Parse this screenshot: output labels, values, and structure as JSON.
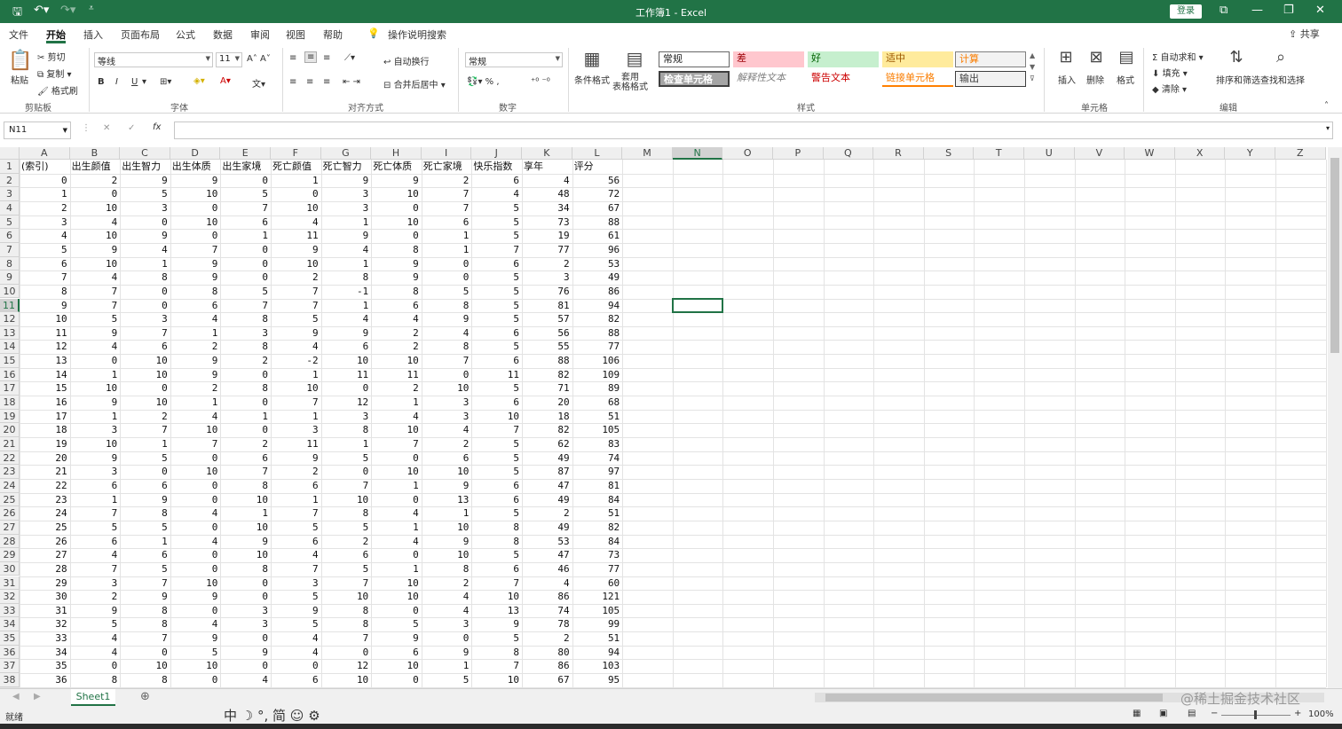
{
  "app": {
    "window_title": "工作簿1  -  Excel",
    "login": "登录"
  },
  "menu": [
    "文件",
    "开始",
    "插入",
    "页面布局",
    "公式",
    "数据",
    "审阅",
    "视图",
    "帮助"
  ],
  "menu_active": "开始",
  "tell_me": "操作说明搜索",
  "share": "共享",
  "ribbon": {
    "clipboard": {
      "paste": "粘贴",
      "cut": "剪切",
      "copy": "复制",
      "format_painter": "格式刷",
      "label": "剪贴板"
    },
    "font": {
      "name": "等线",
      "size": "11",
      "bold": "B",
      "italic": "I",
      "underline": "U",
      "label": "字体"
    },
    "align": {
      "wrap": "自动换行",
      "merge": "合并后居中",
      "label": "对齐方式"
    },
    "number": {
      "format": "常规",
      "label": "数字"
    },
    "styles": {
      "cond_format": "条件格式",
      "table_format": "套用\n表格格式",
      "cells": [
        "常规",
        "差",
        "好",
        "适中",
        "计算",
        "检查单元格",
        "解释性文本",
        "警告文本",
        "链接单元格",
        "输出"
      ],
      "label": "样式"
    },
    "cells": {
      "insert": "插入",
      "delete": "删除",
      "format": "格式",
      "label": "单元格"
    },
    "editing": {
      "autosum": "自动求和",
      "fill": "填充",
      "clear": "清除",
      "sort": "排序和筛选",
      "find": "查找和选择",
      "label": "编辑"
    }
  },
  "namebox": "N11",
  "columns": [
    "A",
    "B",
    "C",
    "D",
    "E",
    "F",
    "G",
    "H",
    "I",
    "J",
    "K",
    "L",
    "M",
    "N",
    "O",
    "P",
    "Q",
    "R",
    "S",
    "T",
    "U",
    "V",
    "W",
    "X",
    "Y",
    "Z"
  ],
  "header_row": [
    "(索引)",
    "出生颜值",
    "出生智力",
    "出生体质",
    "出生家境",
    "死亡颜值",
    "死亡智力",
    "死亡体质",
    "死亡家境",
    "快乐指数",
    "享年",
    "评分"
  ],
  "rows": [
    [
      0,
      2,
      9,
      9,
      0,
      1,
      9,
      9,
      2,
      6,
      4,
      56
    ],
    [
      1,
      0,
      5,
      10,
      5,
      0,
      3,
      10,
      7,
      4,
      48,
      72
    ],
    [
      2,
      10,
      3,
      0,
      7,
      10,
      3,
      0,
      7,
      5,
      34,
      67
    ],
    [
      3,
      4,
      0,
      10,
      6,
      4,
      1,
      10,
      6,
      5,
      73,
      88
    ],
    [
      4,
      10,
      9,
      0,
      1,
      11,
      9,
      0,
      1,
      5,
      19,
      61
    ],
    [
      5,
      9,
      4,
      7,
      0,
      9,
      4,
      8,
      1,
      7,
      77,
      96
    ],
    [
      6,
      10,
      1,
      9,
      0,
      10,
      1,
      9,
      0,
      6,
      2,
      53
    ],
    [
      7,
      4,
      8,
      9,
      0,
      2,
      8,
      9,
      0,
      5,
      3,
      49
    ],
    [
      8,
      7,
      0,
      8,
      5,
      7,
      -1,
      8,
      5,
      5,
      76,
      86
    ],
    [
      9,
      7,
      0,
      6,
      7,
      7,
      1,
      6,
      8,
      5,
      81,
      94
    ],
    [
      10,
      5,
      3,
      4,
      8,
      5,
      4,
      4,
      9,
      5,
      57,
      82
    ],
    [
      11,
      9,
      7,
      1,
      3,
      9,
      9,
      2,
      4,
      6,
      56,
      88
    ],
    [
      12,
      4,
      6,
      2,
      8,
      4,
      6,
      2,
      8,
      5,
      55,
      77
    ],
    [
      13,
      0,
      10,
      9,
      2,
      -2,
      10,
      10,
      7,
      6,
      88,
      106
    ],
    [
      14,
      1,
      10,
      9,
      0,
      1,
      11,
      11,
      0,
      11,
      82,
      109
    ],
    [
      15,
      10,
      0,
      2,
      8,
      10,
      0,
      2,
      10,
      5,
      71,
      89
    ],
    [
      16,
      9,
      10,
      1,
      0,
      7,
      12,
      1,
      3,
      6,
      20,
      68
    ],
    [
      17,
      1,
      2,
      4,
      1,
      1,
      3,
      4,
      3,
      10,
      18,
      51
    ],
    [
      18,
      3,
      7,
      10,
      0,
      3,
      8,
      10,
      4,
      7,
      82,
      105
    ],
    [
      19,
      10,
      1,
      7,
      2,
      11,
      1,
      7,
      2,
      5,
      62,
      83
    ],
    [
      20,
      9,
      5,
      0,
      6,
      9,
      5,
      0,
      6,
      5,
      49,
      74
    ],
    [
      21,
      3,
      0,
      10,
      7,
      2,
      0,
      10,
      10,
      5,
      87,
      97
    ],
    [
      22,
      6,
      6,
      0,
      8,
      6,
      7,
      1,
      9,
      6,
      47,
      81
    ],
    [
      23,
      1,
      9,
      0,
      10,
      1,
      10,
      0,
      13,
      6,
      49,
      84
    ],
    [
      24,
      7,
      8,
      4,
      1,
      7,
      8,
      4,
      1,
      5,
      2,
      51
    ],
    [
      25,
      5,
      5,
      0,
      10,
      5,
      5,
      1,
      10,
      8,
      49,
      82
    ],
    [
      26,
      6,
      1,
      4,
      9,
      6,
      2,
      4,
      9,
      8,
      53,
      84
    ],
    [
      27,
      4,
      6,
      0,
      10,
      4,
      6,
      0,
      10,
      5,
      47,
      73
    ],
    [
      28,
      7,
      5,
      0,
      8,
      7,
      5,
      1,
      8,
      6,
      46,
      77
    ],
    [
      29,
      3,
      7,
      10,
      0,
      3,
      7,
      10,
      2,
      7,
      4,
      60
    ],
    [
      30,
      2,
      9,
      9,
      0,
      5,
      10,
      10,
      4,
      10,
      86,
      121
    ],
    [
      31,
      9,
      8,
      0,
      3,
      9,
      8,
      0,
      4,
      13,
      74,
      105
    ],
    [
      32,
      5,
      8,
      4,
      3,
      5,
      8,
      5,
      3,
      9,
      78,
      99
    ],
    [
      33,
      4,
      7,
      9,
      0,
      4,
      7,
      9,
      0,
      5,
      2,
      51
    ],
    [
      34,
      4,
      0,
      5,
      9,
      4,
      0,
      6,
      9,
      8,
      80,
      94
    ],
    [
      35,
      0,
      10,
      10,
      0,
      0,
      12,
      10,
      1,
      7,
      86,
      103
    ],
    [
      36,
      8,
      8,
      0,
      4,
      6,
      10,
      0,
      5,
      10,
      67,
      95
    ]
  ],
  "sheet_tab": "Sheet1",
  "status": {
    "ready": "就绪",
    "ime": "中 ☽ °, 简 ☺ ⚙",
    "zoom": "100%"
  },
  "watermark": "@稀土掘金技术社区"
}
